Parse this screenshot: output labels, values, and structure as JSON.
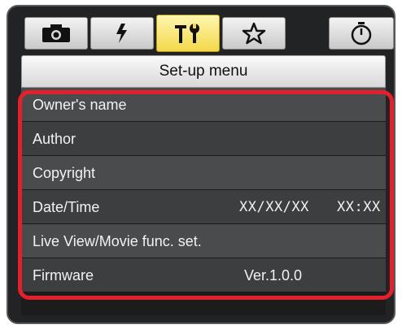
{
  "title": "Set-up menu",
  "tabs": [
    {
      "icon": "camera-icon",
      "active": false
    },
    {
      "icon": "flash-icon",
      "active": false
    },
    {
      "icon": "tools-icon",
      "active": true
    },
    {
      "icon": "star-icon",
      "active": false
    },
    {
      "icon": "timer-icon",
      "active": false
    }
  ],
  "items": [
    {
      "label": "Owner's name"
    },
    {
      "label": "Author"
    },
    {
      "label": "Copyright"
    },
    {
      "label": "Date/Time",
      "date": "XX/XX/XX",
      "time": "XX:XX"
    },
    {
      "label": "Live View/Movie func. set."
    },
    {
      "label": "Firmware",
      "value": "Ver.1.0.0"
    }
  ],
  "colors": {
    "active_tab": "#f2d84a",
    "highlight_border": "#e3202b",
    "panel_bg": "#222325"
  }
}
